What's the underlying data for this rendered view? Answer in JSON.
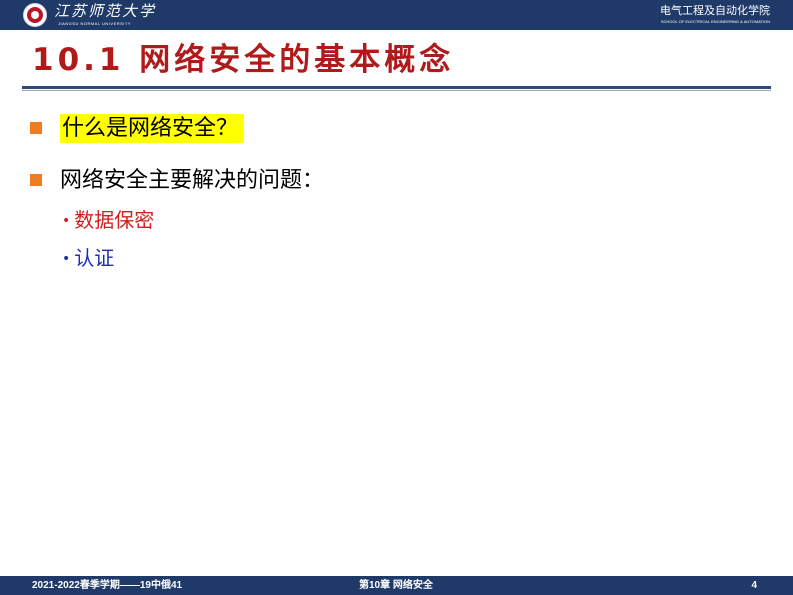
{
  "header": {
    "university_name_cn": "江苏师范大学",
    "university_name_en": "JIANGSU NORMAL UNIVERSITY",
    "school_name_cn": "电气工程及自动化学院",
    "school_name_en": "SCHOOL OF ELECTRICAL ENGINEERING & AUTOMATION",
    "logo_icon": "university-seal-icon"
  },
  "slide": {
    "title": "10.1 网络安全的基本概念",
    "bullets": [
      {
        "text": "什么是网络安全？",
        "highlighted": true
      },
      {
        "text": "网络安全主要解决的问题：",
        "highlighted": false
      }
    ],
    "sub_items": [
      {
        "marker": "•",
        "text": "数据保密",
        "color": "#d1211e"
      },
      {
        "marker": "•",
        "text": "认证",
        "color": "#1b2fb0"
      }
    ]
  },
  "footer": {
    "left": "2021-2022春季学期——19中俄41",
    "center": "第10章 网络安全",
    "page_number": "4"
  },
  "colors": {
    "header_bg": "#1f3a68",
    "title": "#b01a1a",
    "bullet_square": "#ee7c20",
    "highlight": "#ffff00"
  }
}
